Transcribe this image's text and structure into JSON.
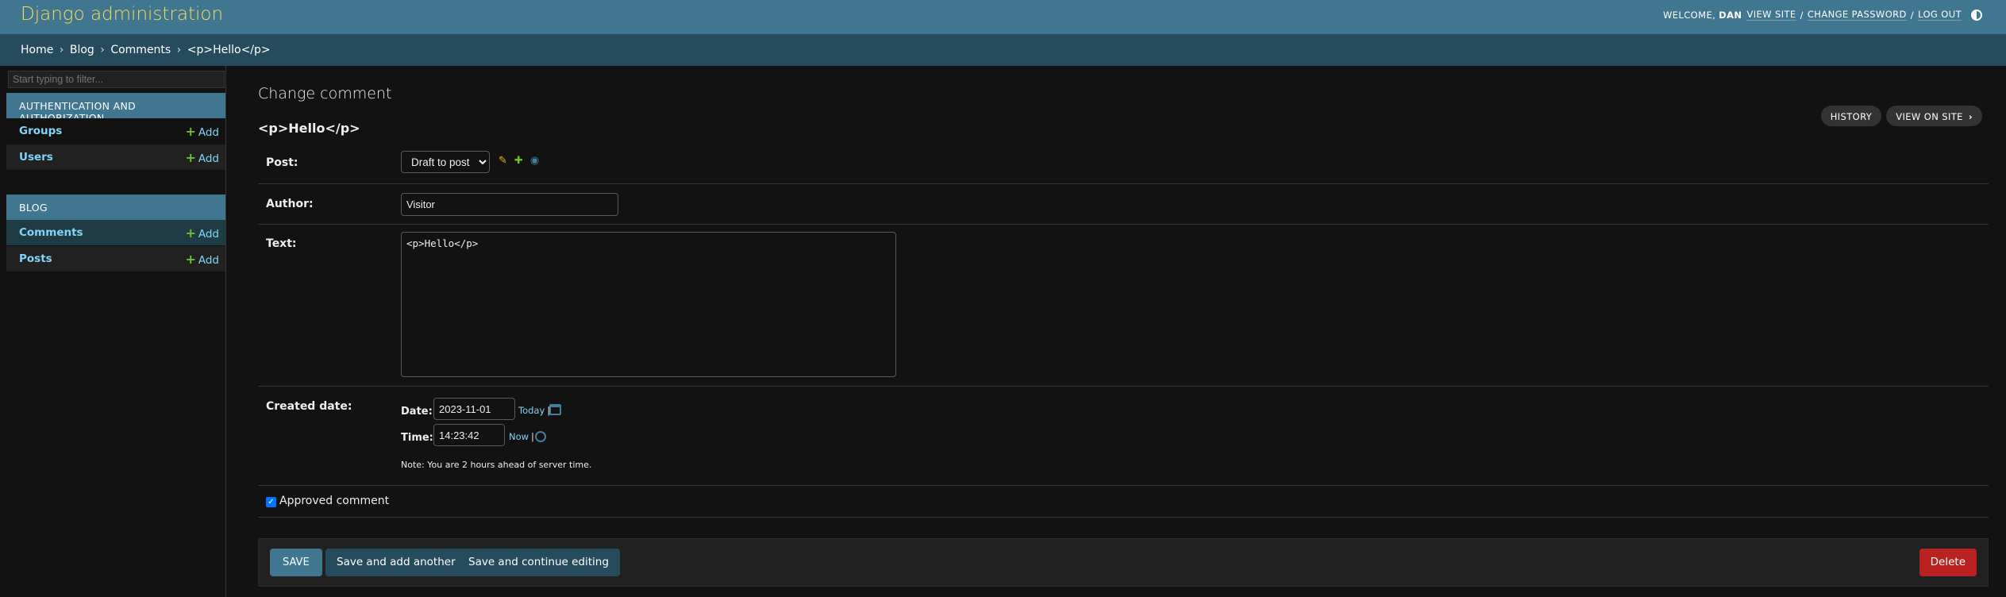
{
  "header": {
    "site_name": "Django administration",
    "welcome": "WELCOME,",
    "user": "DAN",
    "view_site": "VIEW SITE",
    "change_password": "CHANGE PASSWORD",
    "log_out": "LOG OUT",
    "separator": "/"
  },
  "breadcrumbs": {
    "home": "Home",
    "app": "Blog",
    "model": "Comments",
    "current": "<p>Hello</p>",
    "separator": "›"
  },
  "sidebar": {
    "filter_placeholder": "Start typing to filter...",
    "add_label": "Add",
    "apps": [
      {
        "caption": "AUTHENTICATION AND AUTHORIZATION",
        "models": [
          "Groups",
          "Users"
        ]
      },
      {
        "caption": "BLOG",
        "models": [
          "Comments",
          "Posts"
        ],
        "current": "Comments"
      }
    ]
  },
  "page": {
    "title": "Change comment",
    "object_title": "<p>Hello</p>",
    "history_label": "HISTORY",
    "view_on_site_label": "VIEW ON SITE"
  },
  "form": {
    "post_label": "Post:",
    "post_value": "Draft to post",
    "author_label": "Author:",
    "author_value": "Visitor",
    "text_label": "Text:",
    "text_value": "<p>Hello</p>",
    "created_label": "Created date:",
    "date_label": "Date:",
    "date_value": "2023-11-01",
    "today_label": "Today",
    "time_label": "Time:",
    "time_value": "14:23:42",
    "now_label": "Now",
    "link_separator": "|",
    "tz_note": "Note: You are 2 hours ahead of server time.",
    "approved_label": "Approved comment",
    "approved_checked": true
  },
  "actions": {
    "save": "SAVE",
    "save_add_another": "Save and add another",
    "save_continue": "Save and continue editing",
    "delete": "Delete"
  },
  "colors": {
    "header": "#417690",
    "breadcrumbs": "#264b5d",
    "brand_text": "#f5dd5d",
    "link": "#81d4fa",
    "delete": "#ba2121",
    "add_icon": "#70bf2b"
  }
}
